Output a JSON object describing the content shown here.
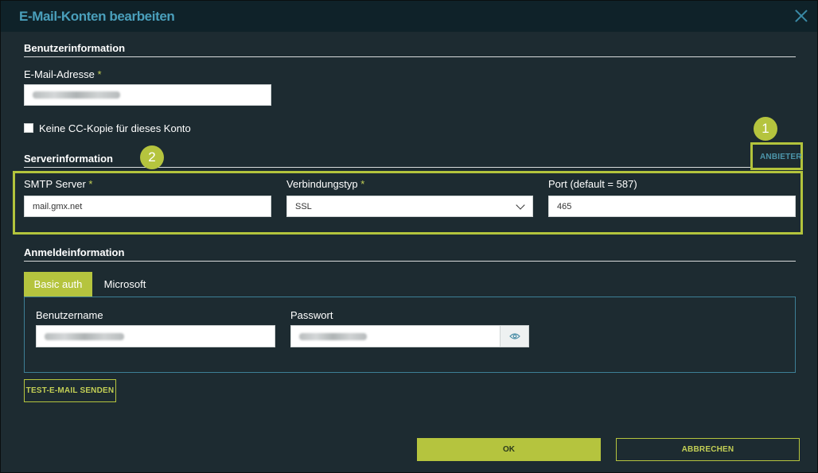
{
  "dialog": {
    "title": "E-Mail-Konten bearbeiten"
  },
  "user_section": {
    "title": "Benutzerinformation",
    "email_label": "E-Mail-Adresse",
    "required_mark": "*",
    "no_cc_label": "Keine CC-Kopie für dieses Konto",
    "no_cc_checked": false
  },
  "server_section": {
    "title": "Serverinformation",
    "provider_button": "ANBIETER",
    "smtp_label": "SMTP Server",
    "smtp_value": "mail.gmx.net",
    "connection_label": "Verbindungstyp",
    "connection_value": "SSL",
    "port_label": "Port (default = 587)",
    "port_value": "465"
  },
  "callouts": {
    "one": "1",
    "two": "2"
  },
  "login_section": {
    "title": "Anmeldeinformation",
    "tabs": [
      "Basic auth",
      "Microsoft"
    ],
    "username_label": "Benutzername",
    "password_label": "Passwort"
  },
  "actions": {
    "test_email": "TEST-E-MAIL SENDEN",
    "ok": "OK",
    "cancel": "ABBRECHEN"
  },
  "colors": {
    "accent": "#b5c43e",
    "title_blue": "#4a9fbb",
    "background": "#1d2b31",
    "titlebar": "#0f2229"
  },
  "icons": {
    "close": "close-icon",
    "chevron": "chevron-down-icon",
    "eye": "eye-icon"
  }
}
